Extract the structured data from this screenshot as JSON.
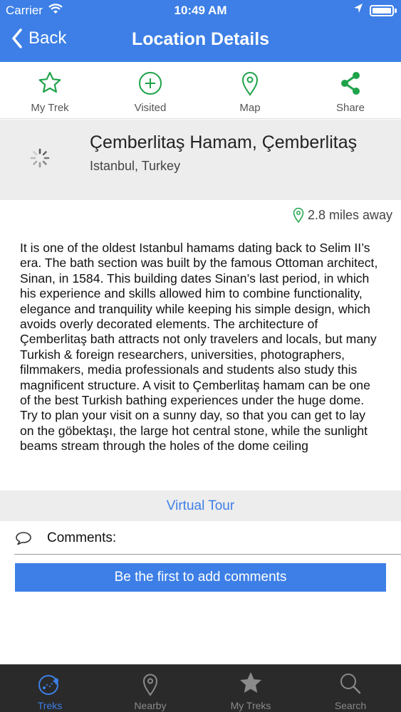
{
  "status_bar": {
    "carrier": "Carrier",
    "time": "10:49 AM"
  },
  "nav": {
    "back_label": "Back",
    "title": "Location Details"
  },
  "actions": [
    {
      "label": "My Trek",
      "icon": "star-icon"
    },
    {
      "label": "Visited",
      "icon": "plus-circle-icon"
    },
    {
      "label": "Map",
      "icon": "map-pin-icon"
    },
    {
      "label": "Share",
      "icon": "share-icon"
    }
  ],
  "place": {
    "name": "Çemberlitaş Hamam, Çemberlitaş",
    "location": "Istanbul, Turkey"
  },
  "distance": "2.8 miles away",
  "description": "It is one of the oldest Istanbul hamams dating back to Selim II’s era. The bath section was built by the famous Ottoman architect, Sinan, in 1584. This building dates Sinan’s last period, in which his experience and skills allowed him to combine functionality, elegance and tranquility while keeping his simple design, which avoids overly decorated elements. The architecture of Çemberlitaş bath attracts not only travelers and locals, but many Turkish & foreign researchers, universities, photographers, filmmakers, media professionals and students also study this magnificent structure. A visit to Çemberlitaş hamam can be one of the best Turkish bathing experiences under the huge dome. Try to plan your visit on a sunny day, so that you can get to lay on the göbektaşı, the large hot central stone, while the sunlight beams stream through the holes of the dome ceiling",
  "virtual_tour_label": "Virtual Tour",
  "comments": {
    "label": "Comments:",
    "add_button": "Be the first to add comments"
  },
  "tabs": [
    {
      "label": "Treks",
      "icon": "treks-icon",
      "active": true
    },
    {
      "label": "Nearby",
      "icon": "map-pin-icon",
      "active": false
    },
    {
      "label": "My Treks",
      "icon": "star-icon",
      "active": false
    },
    {
      "label": "Search",
      "icon": "search-icon",
      "active": false
    }
  ],
  "colors": {
    "accent": "#3d7fe6",
    "green": "#1fa34a",
    "tab_bar": "#2a2a2a",
    "band": "#ededed"
  }
}
